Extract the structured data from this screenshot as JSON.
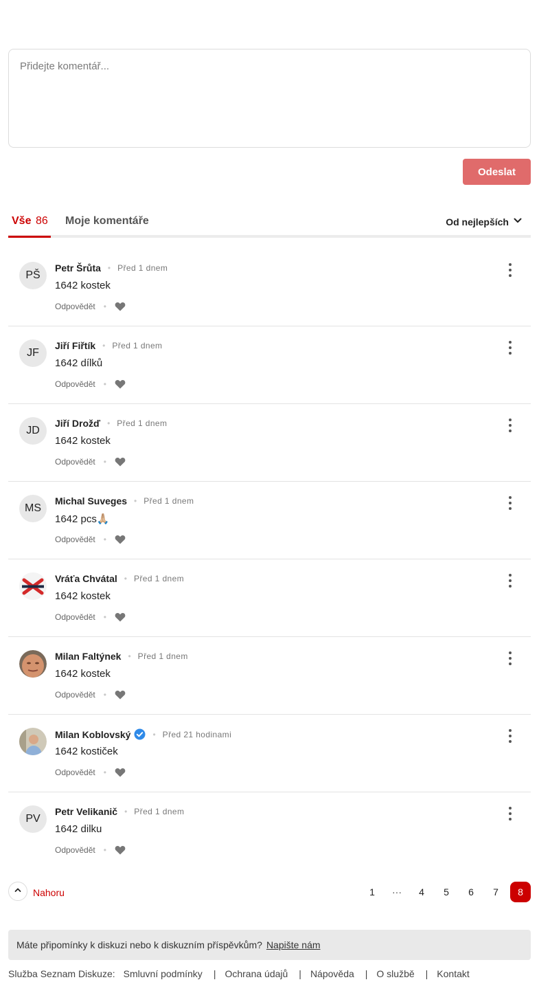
{
  "composer": {
    "placeholder": "Přidejte komentář...",
    "send_label": "Odeslat"
  },
  "tabs": {
    "all_label": "Vše",
    "all_count": "86",
    "mine_label": "Moje komentáře",
    "sort_label": "Od nejlepších"
  },
  "comments": [
    {
      "initials": "PŠ",
      "author": "Petr Šrůta",
      "time": "Před 1 dnem",
      "text": "1642 kostek",
      "reply": "Odpovědět"
    },
    {
      "initials": "JF",
      "author": "Jiří Fiřtík",
      "time": "Před 1 dnem",
      "text": "1642 dílků",
      "reply": "Odpovědět"
    },
    {
      "initials": "JD",
      "author": "Jiří Drožď",
      "time": "Před 1 dnem",
      "text": "1642 kostek",
      "reply": "Odpovědět"
    },
    {
      "initials": "MS",
      "author": "Michal Suveges",
      "time": "Před 1 dnem",
      "text": "1642 pcs🙏🏼",
      "reply": "Odpovědět"
    },
    {
      "initials": "",
      "author": "Vráťa Chvátal",
      "time": "Před 1 dnem",
      "text": "1642 kostek",
      "reply": "Odpovědět"
    },
    {
      "initials": "",
      "author": "Milan Faltýnek",
      "time": "Před 1 dnem",
      "text": "1642 kostek",
      "reply": "Odpovědět"
    },
    {
      "initials": "",
      "author": "Milan Koblovský",
      "time": "Před 21 hodinami",
      "text": "1642 kostiček",
      "reply": "Odpovědět"
    },
    {
      "initials": "PV",
      "author": "Petr Velikanič",
      "time": "Před 1 dnem",
      "text": "1642 dilku",
      "reply": "Odpovědět"
    }
  ],
  "pagination": {
    "up_label": "Nahoru",
    "pages": [
      "1",
      "···",
      "4",
      "5",
      "6",
      "7",
      "8"
    ],
    "current": "8"
  },
  "feedback": {
    "text": "Máte připomínky k diskuzi nebo k diskuzním příspěvkům?",
    "link": "Napište nám"
  },
  "footer": {
    "service": "Služba Seznam Diskuze:",
    "links": [
      "Smluvní podmínky",
      "Ochrana údajů",
      "Nápověda",
      "O službě",
      "Kontakt"
    ]
  },
  "colors": {
    "accent": "#cc0000",
    "send_button": "#e06b6b",
    "verified": "#2f8ae8"
  },
  "icons": [
    "chevron-down-icon",
    "heart-icon",
    "more-vertical-icon",
    "verified-badge-icon",
    "chevron-up-icon"
  ]
}
